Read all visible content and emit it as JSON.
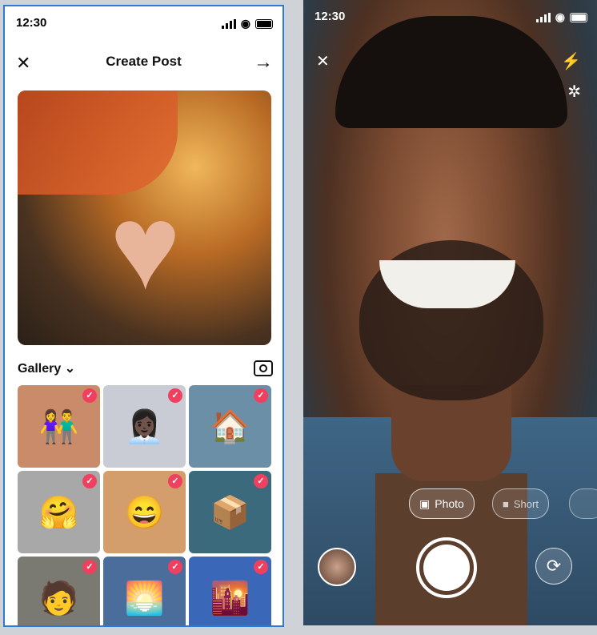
{
  "status": {
    "time": "12:30"
  },
  "left": {
    "title": "Create Post",
    "gallery_label": "Gallery",
    "gallery_chevron": "⌄",
    "close_icon": "✕",
    "next_icon": "→",
    "grid": [
      {
        "emoji": "👫",
        "bg": "#c98b6a",
        "checked": "✓"
      },
      {
        "emoji": "👩🏿‍💼",
        "bg": "#c9ccd4",
        "checked": "✓"
      },
      {
        "emoji": "🏠",
        "bg": "#6c8fa8",
        "checked": "✓"
      },
      {
        "emoji": "🤗",
        "bg": "#a8a8a8",
        "checked": "✓"
      },
      {
        "emoji": "😄",
        "bg": "#d49e6c",
        "checked": "✓"
      },
      {
        "emoji": "📦",
        "bg": "#3b6a7c",
        "checked": "✓"
      },
      {
        "emoji": "🧑",
        "bg": "#7b7a72",
        "checked": "✓"
      },
      {
        "emoji": "🌅",
        "bg": "#4b6d9c",
        "checked": "✓"
      },
      {
        "emoji": "🌇",
        "bg": "#3a67b8",
        "checked": "✓"
      }
    ]
  },
  "right": {
    "close_icon": "✕",
    "flash_icon": "⚡",
    "flash_off_icon": "✲",
    "mode_photo": "Photo",
    "mode_short": "Short",
    "flip_icon": "⟳"
  }
}
